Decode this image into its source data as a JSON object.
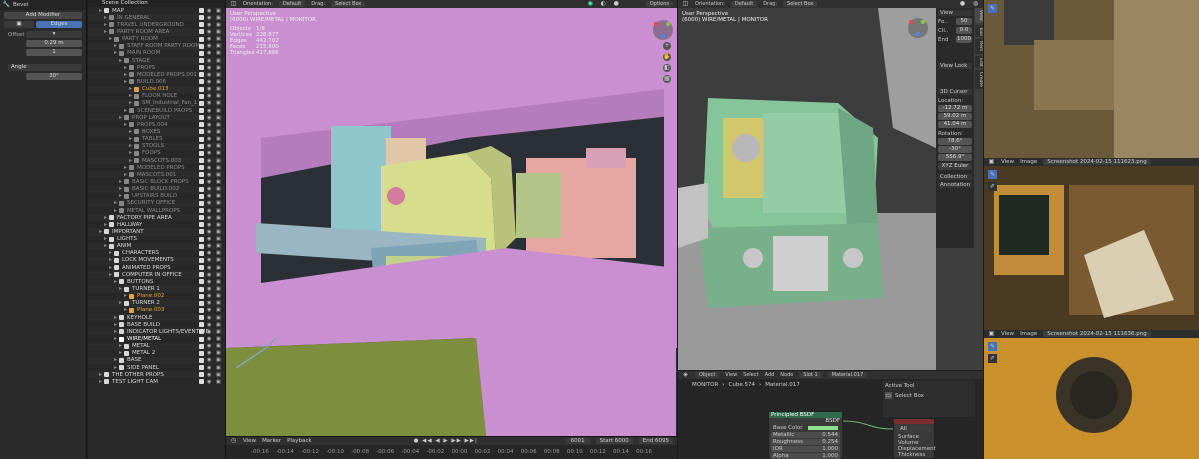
{
  "modifier_panel": {
    "title": "Bevel",
    "add_modifier": "Add Modifier",
    "mode_tab": "Edges",
    "offset_label": "Offset",
    "offset_value": "0.29 m",
    "segments_value": "1",
    "limit_label": "Angle",
    "angle_value": "30°"
  },
  "outliner": {
    "title": "Scene Collection",
    "rows": [
      {
        "indent": 1,
        "name": "MAP",
        "color": "#d8d8d8",
        "dim": false
      },
      {
        "indent": 2,
        "name": "IN GENERAL",
        "color": "#888",
        "dim": true
      },
      {
        "indent": 2,
        "name": "TRAVEL UNDERGROUND",
        "color": "#888",
        "dim": true
      },
      {
        "indent": 2,
        "name": "PARTY ROOM AREA",
        "color": "#888",
        "dim": true
      },
      {
        "indent": 3,
        "name": "PARTY ROOM",
        "color": "#888",
        "dim": true
      },
      {
        "indent": 4,
        "name": "STAFF ROOM PARTY ROOM",
        "color": "#888",
        "dim": true
      },
      {
        "indent": 4,
        "name": "MAIN ROOM",
        "color": "#888",
        "dim": true
      },
      {
        "indent": 5,
        "name": "STAGE",
        "color": "#888",
        "dim": true
      },
      {
        "indent": 6,
        "name": "PROPS",
        "color": "#888",
        "dim": true
      },
      {
        "indent": 6,
        "name": "MODELED PROPS.001",
        "color": "#888",
        "dim": true
      },
      {
        "indent": 6,
        "name": "BUILD.006",
        "color": "#888",
        "dim": true
      },
      {
        "indent": 7,
        "name": "Cube.013",
        "color": "#e8a33c",
        "dim": false
      },
      {
        "indent": 7,
        "name": "FLOOR HOLE",
        "color": "#888",
        "dim": true
      },
      {
        "indent": 7,
        "name": "SM_Industrial_Fan_1",
        "color": "#888",
        "dim": true
      },
      {
        "indent": 6,
        "name": "SCENEBUILD PROPS",
        "color": "#888",
        "dim": true
      },
      {
        "indent": 5,
        "name": "PROP LAYOUT",
        "color": "#888",
        "dim": true
      },
      {
        "indent": 6,
        "name": "PROPS.004",
        "color": "#888",
        "dim": true
      },
      {
        "indent": 7,
        "name": "BOXES",
        "color": "#888",
        "dim": true
      },
      {
        "indent": 7,
        "name": "TABLES",
        "color": "#888",
        "dim": true
      },
      {
        "indent": 7,
        "name": "STOOLS",
        "color": "#888",
        "dim": true
      },
      {
        "indent": 7,
        "name": "FOOPS",
        "color": "#888",
        "dim": true
      },
      {
        "indent": 7,
        "name": "MASCOTS.003",
        "color": "#888",
        "dim": true
      },
      {
        "indent": 6,
        "name": "MODELED PROPS",
        "color": "#888",
        "dim": true
      },
      {
        "indent": 6,
        "name": "MASCOTS.001",
        "color": "#888",
        "dim": true
      },
      {
        "indent": 5,
        "name": "BASIC BLOCK PROPS",
        "color": "#888",
        "dim": true
      },
      {
        "indent": 5,
        "name": "BASIC BUILD.002",
        "color": "#888",
        "dim": true
      },
      {
        "indent": 5,
        "name": "UPSTAIRS BUILD",
        "color": "#888",
        "dim": true
      },
      {
        "indent": 4,
        "name": "SECURITY OFFICE",
        "color": "#888",
        "dim": true
      },
      {
        "indent": 4,
        "name": "METAL WALLPROPS",
        "color": "#888",
        "dim": true
      },
      {
        "indent": 2,
        "name": "FACTORY PIPE AREA",
        "color": "#d8d8d8",
        "dim": false
      },
      {
        "indent": 2,
        "name": "HALLWAY",
        "color": "#d8d8d8",
        "dim": false
      },
      {
        "indent": 1,
        "name": "IMPORTANT",
        "color": "#d8d8d8",
        "dim": false
      },
      {
        "indent": 2,
        "name": "LIGHTS",
        "color": "#d8d8d8",
        "dim": false
      },
      {
        "indent": 2,
        "name": "ANIM",
        "color": "#d8d8d8",
        "dim": false
      },
      {
        "indent": 3,
        "name": "CHARACTERS",
        "color": "#d8d8d8",
        "dim": false
      },
      {
        "indent": 3,
        "name": "LOCK MOVEMENTS",
        "color": "#d8d8d8",
        "dim": false
      },
      {
        "indent": 3,
        "name": "ANIMATED PROPS",
        "color": "#d8d8d8",
        "dim": false
      },
      {
        "indent": 3,
        "name": "COMPUTER IN OFFICE",
        "color": "#d8d8d8",
        "dim": false
      },
      {
        "indent": 4,
        "name": "BUTTONS",
        "color": "#d8d8d8",
        "dim": false
      },
      {
        "indent": 5,
        "name": "TURNER 1",
        "color": "#d8d8d8",
        "dim": false
      },
      {
        "indent": 6,
        "name": "Plane.002",
        "color": "#e8a33c",
        "dim": false
      },
      {
        "indent": 5,
        "name": "TURNER 2",
        "color": "#d8d8d8",
        "dim": false
      },
      {
        "indent": 6,
        "name": "Plane.003",
        "color": "#e8a33c",
        "dim": false
      },
      {
        "indent": 4,
        "name": "KEYHOLE",
        "color": "#d8d8d8",
        "dim": false
      },
      {
        "indent": 4,
        "name": "BASE BUILD",
        "color": "#d8d8d8",
        "dim": false
      },
      {
        "indent": 4,
        "name": "INDICATOR LIGHTS/EVENT ME",
        "color": "#d8d8d8",
        "dim": false
      },
      {
        "indent": 4,
        "name": "WIRE/METAL",
        "color": "#ffffff",
        "dim": false
      },
      {
        "indent": 5,
        "name": "METAL",
        "color": "#d8d8d8",
        "dim": false
      },
      {
        "indent": 5,
        "name": "METAL 2",
        "color": "#d8d8d8",
        "dim": false
      },
      {
        "indent": 4,
        "name": "BASE",
        "color": "#d8d8d8",
        "dim": false
      },
      {
        "indent": 4,
        "name": "SIDE PANEL",
        "color": "#d8d8d8",
        "dim": false
      },
      {
        "indent": 1,
        "name": "THE OTHER PROPS",
        "color": "#d8d8d8",
        "dim": false
      },
      {
        "indent": 1,
        "name": "TEST LIGHT CAM",
        "color": "#d8d8d8",
        "dim": false
      }
    ]
  },
  "viewport_left": {
    "orientation_label": "Orientation:",
    "orientation_value": "Default",
    "drag_label": "Drag:",
    "drag_value": "Select Box",
    "options": "Options",
    "view_name": "User Perspective",
    "object_name": "(6000) WIRE/METAL | MONITOR",
    "stats": [
      {
        "label": "Objects",
        "value": "1/8"
      },
      {
        "label": "Vertices",
        "value": "228,877"
      },
      {
        "label": "Edges",
        "value": "442,702"
      },
      {
        "label": "Faces",
        "value": "215,800"
      },
      {
        "label": "Triangles",
        "value": "417,866"
      }
    ]
  },
  "timeline": {
    "menus": [
      "View",
      "Marker",
      "Playback"
    ],
    "frame": "6001",
    "start_label": "Start",
    "start": "6000",
    "end_label": "End",
    "end": "6095",
    "ticks": [
      "-00:16",
      "-00:14",
      "-00:12",
      "-00:10",
      "-00:08",
      "-00:06",
      "-00:04",
      "-00:02",
      "00:00",
      "00:02",
      "00:04",
      "00:06",
      "00:08",
      "00:10",
      "00:12",
      "00:14",
      "00:16"
    ]
  },
  "viewport_right": {
    "orientation_label": "Orientation:",
    "orientation_value": "Default",
    "drag_label": "Drag:",
    "drag_value": "Select Box",
    "view_name": "User Perspective",
    "object_name": "(6000) WIRE/METAL | MONITOR",
    "npanel": {
      "view_header": "View",
      "view_lock": "View Lock",
      "cursor_header": "3D Cursor",
      "location": "Location:",
      "loc_x": "-12.72 m",
      "loc_y": "59.02 m",
      "loc_z": "41.04 m",
      "rotation": "Rotation:",
      "rot_x": "78.6°",
      "rot_y": "-30°",
      "rot_z": "556.9°",
      "rot_mode": "XYZ Euler",
      "collection": "Collection",
      "annotation": "Annotation",
      "focal": "50",
      "clip_start": "0.0",
      "clip_end": "1000",
      "tabs": [
        "View",
        "Tool",
        "Item",
        "Edit",
        "Create"
      ]
    }
  },
  "node_editor": {
    "mode": "Object",
    "menus": [
      "View",
      "Select",
      "Add",
      "Node"
    ],
    "slot": "Slot 1",
    "material": "Material.017",
    "breadcrumb": [
      "MONITOR",
      "Cube.574",
      "Material.017"
    ],
    "node_title": "Principled BSDF",
    "node_output": "BSDF",
    "sockets": [
      {
        "label": "Base Color",
        "value": ""
      },
      {
        "label": "Metallic",
        "value": "0.544"
      },
      {
        "label": "Roughness",
        "value": "0.254"
      },
      {
        "label": "IOR",
        "value": "1.000"
      },
      {
        "label": "Alpha",
        "value": "1.000"
      }
    ],
    "output_node_options": [
      "All"
    ],
    "output_sockets": [
      "Surface",
      "Volume",
      "Displacement",
      "Thickness"
    ],
    "active_tool_header": "Active Tool",
    "active_tool": "Select Box"
  },
  "image_editors": [
    {
      "menus": [
        "View",
        "Image"
      ],
      "filename": "Screenshot 2024-02-15 111623.png"
    },
    {
      "menus": [
        "View",
        "Image"
      ],
      "filename": "Screenshot 2024-02-15 111636.png"
    }
  ],
  "colors": {
    "pink": "#c98fd0",
    "yellow_green": "#d6de8e",
    "mint": "#79c8a0",
    "bluegrey": "#7fa4b5"
  }
}
